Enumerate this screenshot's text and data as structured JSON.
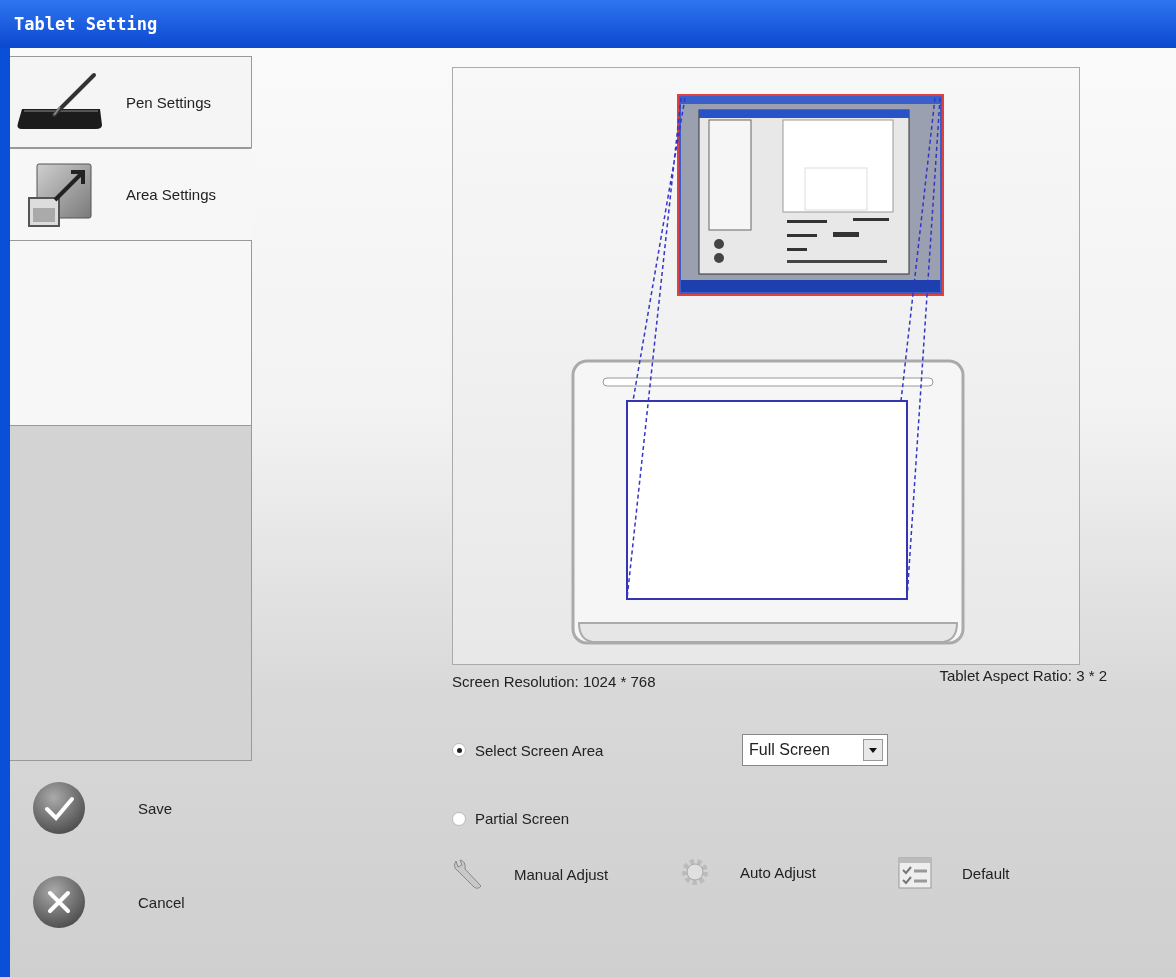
{
  "window": {
    "title": "Tablet Setting"
  },
  "tabs": [
    {
      "label": "Pen Settings",
      "kind": "pen",
      "selected": false
    },
    {
      "label": "Area Settings",
      "kind": "area",
      "selected": true
    }
  ],
  "sidebar_buttons": [
    {
      "label": "Save",
      "kind": "save"
    },
    {
      "label": "Cancel",
      "kind": "cancel"
    }
  ],
  "screen_resolution": "Screen Resolution:  1024 * 768",
  "tablet_aspect_ratio": "Tablet Aspect Ratio: 3 * 2",
  "area_options": [
    {
      "label": "Select Screen Area",
      "selected": true
    },
    {
      "label": "Partial Screen",
      "selected": false
    }
  ],
  "screen_area_dropdown": {
    "value": "Full Screen"
  },
  "actions": [
    {
      "label": "Manual Adjust",
      "kind": "wrench"
    },
    {
      "label": "Auto Adjust",
      "kind": "gear"
    },
    {
      "label": "Default",
      "kind": "list"
    }
  ]
}
